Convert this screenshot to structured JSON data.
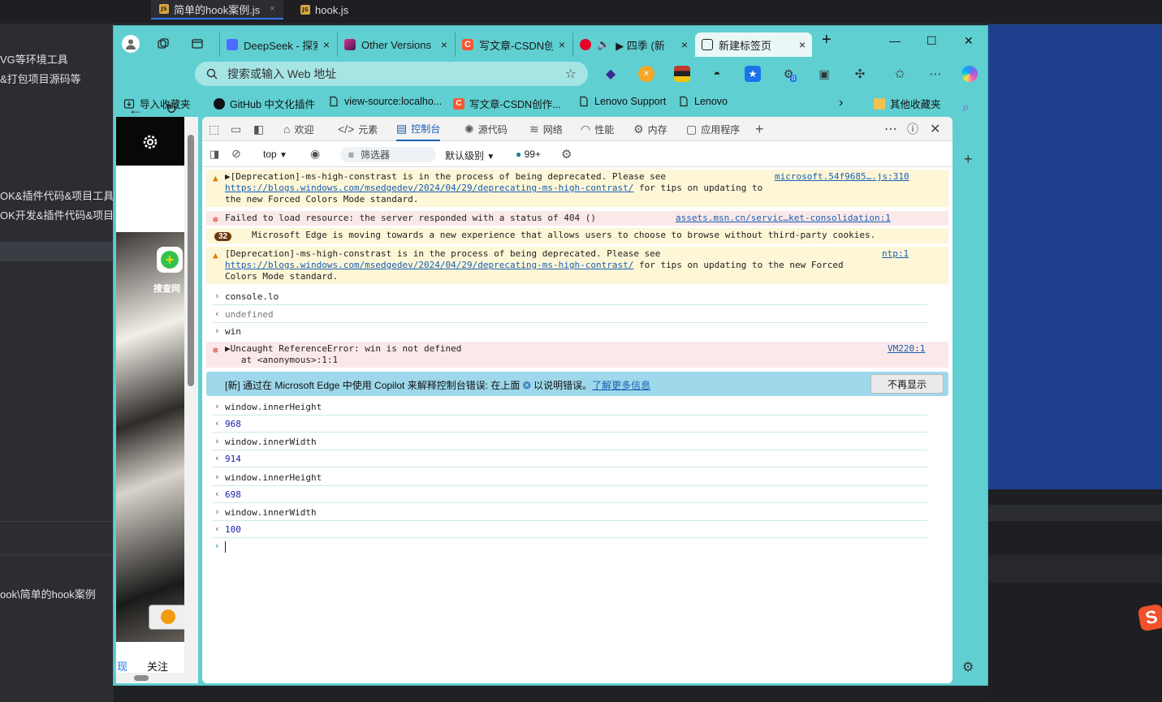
{
  "ide": {
    "tabs": [
      {
        "label": "简单的hook案例.js",
        "close": "×"
      },
      {
        "label": "hook.js"
      }
    ],
    "sidebar_lines": [
      "VG等环境工具",
      "&打包项目源码等",
      "OK&插件代码&项目工具",
      "OK开发&插件代码&项目首页",
      "ook\\简单的hook案例"
    ],
    "sogou": "S"
  },
  "browser": {
    "tabs": [
      {
        "title": "DeepSeek - 探索未至之境",
        "close": "×"
      },
      {
        "title": "Other Versions",
        "close": "×"
      },
      {
        "title": "写文章-CSDN创作中心",
        "close": "×"
      },
      {
        "title": "▶ 四季 (新",
        "close": "×"
      },
      {
        "title": "新建标签页",
        "close": "×"
      }
    ],
    "new_tab": "+",
    "window_controls": {
      "minimize": "—",
      "maximize": "☐",
      "close": "✕"
    },
    "address": {
      "placeholder": "搜索或输入 Web 地址"
    },
    "extension_badge": "0",
    "bookmarks": [
      {
        "label": "导入收藏夹"
      },
      {
        "label": "GitHub 中文化插件"
      },
      {
        "label": "view-source:localho..."
      },
      {
        "label": "写文章-CSDN创作..."
      },
      {
        "label": "Lenovo Support"
      },
      {
        "label": "Lenovo"
      }
    ],
    "other_bookmarks": "其他收藏夹"
  },
  "page": {
    "app_label": "搜查网",
    "bottom_tabs": [
      "现",
      "关注"
    ]
  },
  "devtools": {
    "tabs": [
      {
        "label": "欢迎"
      },
      {
        "label": "元素"
      },
      {
        "label": "控制台"
      },
      {
        "label": "源代码"
      },
      {
        "label": "网络"
      },
      {
        "label": "性能"
      },
      {
        "label": "内存"
      },
      {
        "label": "应用程序"
      }
    ],
    "context": "top",
    "filter_placeholder": "筛选器",
    "level": "默认级别",
    "issues_count": "99+",
    "messages": [
      {
        "level": "warning",
        "text": "[Deprecation]-ms-high-constrast is in the process of being deprecated. Please see",
        "link": "https://blogs.windows.com/msedgedev/2024/04/29/deprecating-ms-high-contrast/",
        "after": " for tips on updating to",
        "tail": "the new Forced Colors Mode standard.",
        "source": "microsoft.54f9685….js:310"
      },
      {
        "level": "error",
        "text": "Failed to load resource: the server responded with a status of 404 ()",
        "source": "assets.msn.cn/servic…ket-consolidation:1"
      },
      {
        "level": "warning",
        "count": "32",
        "text": "Microsoft Edge is moving towards a new experience that allows users to choose to browse without third-party cookies."
      },
      {
        "level": "warning",
        "text": "[Deprecation]-ms-high-constrast is in the process of being deprecated. Please see",
        "link": "https://blogs.windows.com/msedgedev/2024/04/29/deprecating-ms-high-contrast/",
        "after": " for tips on updating to the new Forced",
        "tail": "Colors Mode standard.",
        "source": "ntp:1"
      }
    ],
    "entries1": [
      {
        "kind": "input",
        "text": "console.lo"
      },
      {
        "kind": "result",
        "text": "undefined"
      },
      {
        "kind": "input",
        "text": "win"
      }
    ],
    "error": {
      "text": "Uncaught ReferenceError: win is not defined",
      "detail": "at <anonymous>:1:1",
      "source": "VM220:1"
    },
    "copilot_banner": {
      "text": "[新] 通过在 Microsoft Edge 中使用 Copilot 来解释控制台错误: 在上面",
      "text2": "以说明错误。",
      "link": "了解更多信息",
      "button": "不再显示"
    },
    "entries2": [
      {
        "kind": "input",
        "text": "window.innerHeight"
      },
      {
        "kind": "result",
        "text": "968"
      },
      {
        "kind": "input",
        "text": "window.innerWidth"
      },
      {
        "kind": "result",
        "text": "914"
      },
      {
        "kind": "input",
        "text": "window.innerHeight"
      },
      {
        "kind": "result",
        "text": "698"
      },
      {
        "kind": "input",
        "text": "window.innerWidth"
      },
      {
        "kind": "result",
        "text": "100"
      }
    ]
  },
  "colors": {
    "browser_frame": "#5fcfd1",
    "ide_blue": "#1e3f8c",
    "link": "#1a5fb4"
  }
}
